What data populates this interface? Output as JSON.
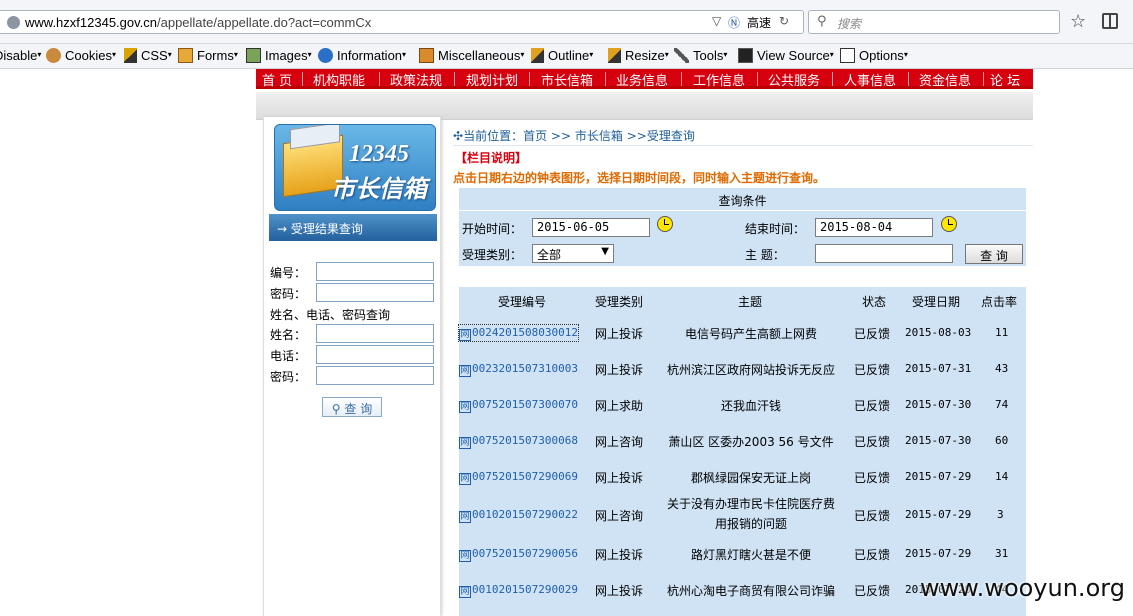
{
  "browser": {
    "url_domain": "www.hzxf12345.gov.cn",
    "url_path": "/appellate/appellate.do?act=commCx",
    "speed_label": "高速",
    "search_placeholder": "搜索"
  },
  "toolbar": {
    "items": [
      "Disable",
      "Cookies",
      "CSS",
      "Forms",
      "Images",
      "Information",
      "Miscellaneous",
      "Outline",
      "Resize",
      "Tools",
      "View Source",
      "Options"
    ]
  },
  "nav": {
    "items": [
      "首 页",
      "机构职能",
      "政策法规",
      "规划计划",
      "市长信箱",
      "业务信息",
      "工作信息",
      "公共服务",
      "人事信息",
      "资金信息",
      "论 坛"
    ]
  },
  "sidebar": {
    "logo_number": "12345",
    "logo_text": "市长信箱",
    "header": "受理结果查询",
    "label_bianhao": "编号：",
    "label_mima": "密码：",
    "note": "姓名、电话、密码查询",
    "label_xingming": "姓名：",
    "label_dianhua": "电话：",
    "label_mima2": "密码：",
    "button": "查 询"
  },
  "breadcrumb": {
    "prefix": "当前位置：",
    "home": "首页",
    "sep1": ">>",
    "mailbox": "市长信箱",
    "sep2": ">>",
    "current": "受理查询"
  },
  "column": {
    "title": "【栏目说明】",
    "description": "点击日期右边的钟表图形，选择日期时间段，同时输入主题进行查询。"
  },
  "query": {
    "header": "查询条件",
    "start_label": "开始时间：",
    "start_value": "2015-06-05",
    "end_label": "结束时间：",
    "end_value": "2015-08-04",
    "type_label": "受理类别：",
    "type_value": "全部",
    "subject_label": "主    题：",
    "subject_value": "",
    "button": "查  询"
  },
  "results": {
    "headers": [
      "受理编号",
      "受理类别",
      "主题",
      "状态",
      "受理日期",
      "点击率"
    ],
    "rows": [
      {
        "id": "0024201508030012",
        "type": "网上投诉",
        "subject": "电信号码产生高额上网费",
        "subject2": "",
        "status": "已反馈",
        "date": "2015-08-03",
        "clicks": "11"
      },
      {
        "id": "0023201507310003",
        "type": "网上投诉",
        "subject": "杭州滨江区政府网站投诉无反应",
        "subject2": "",
        "status": "已反馈",
        "date": "2015-07-31",
        "clicks": "43"
      },
      {
        "id": "0075201507300070",
        "type": "网上求助",
        "subject": "还我血汗钱",
        "subject2": "",
        "status": "已反馈",
        "date": "2015-07-30",
        "clicks": "74"
      },
      {
        "id": "0075201507300068",
        "type": "网上咨询",
        "subject": "萧山区 区委办2003 56 号文件",
        "subject2": "",
        "status": "已反馈",
        "date": "2015-07-30",
        "clicks": "60"
      },
      {
        "id": "0075201507290069",
        "type": "网上投诉",
        "subject": "郡枫绿园保安无证上岗",
        "subject2": "",
        "status": "已反馈",
        "date": "2015-07-29",
        "clicks": "14"
      },
      {
        "id": "0010201507290022",
        "type": "网上咨询",
        "subject": "关于没有办理市民卡住院医疗费",
        "subject2": "用报销的问题",
        "status": "已反馈",
        "date": "2015-07-29",
        "clicks": "3"
      },
      {
        "id": "0075201507290056",
        "type": "网上投诉",
        "subject": "路灯黑灯瞎火甚是不便",
        "subject2": "",
        "status": "已反馈",
        "date": "2015-07-29",
        "clicks": "31"
      },
      {
        "id": "0010201507290029",
        "type": "网上投诉",
        "subject": "杭州心淘电子商贸有限公司诈骗",
        "subject2": "",
        "status": "已反馈",
        "date": "2015-07-29",
        "clicks": "44"
      }
    ]
  },
  "watermark": "www.wooyun.org"
}
